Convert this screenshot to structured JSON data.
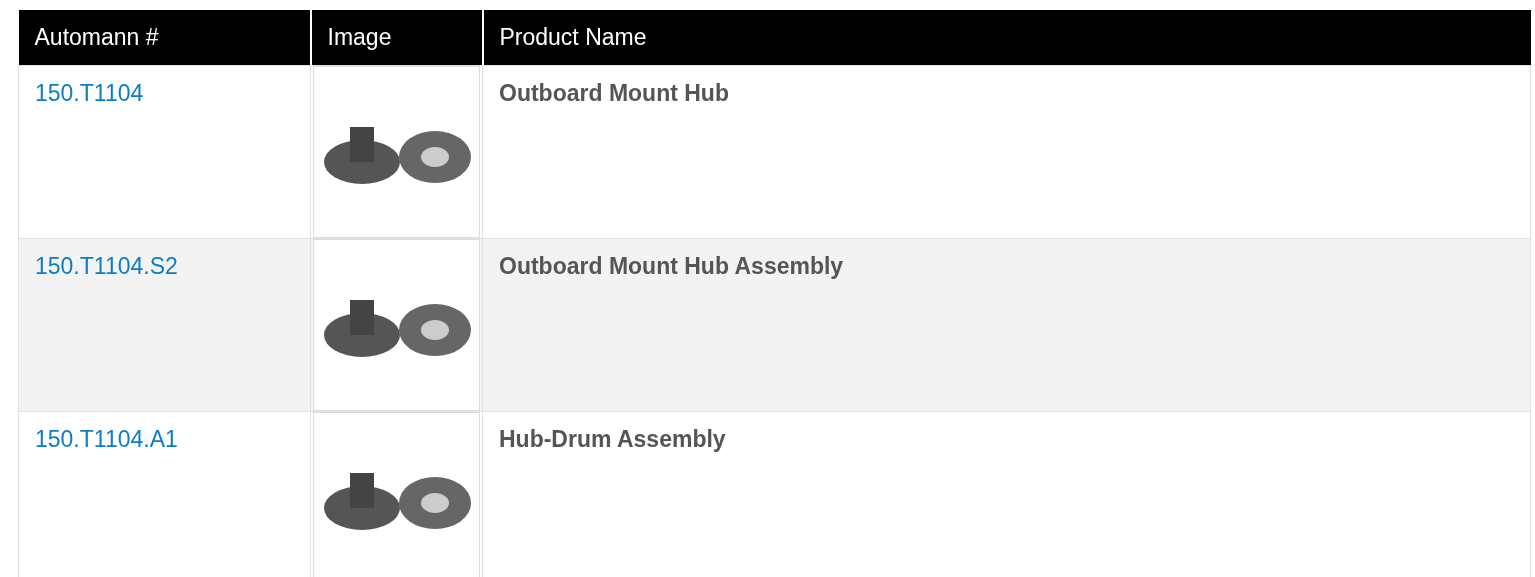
{
  "table": {
    "columns": [
      "Automann #",
      "Image",
      "Product Name"
    ],
    "rows": [
      {
        "part_number": "150.T1104",
        "product_name": "Outboard Mount Hub"
      },
      {
        "part_number": "150.T1104.S2",
        "product_name": "Outboard Mount Hub Assembly"
      },
      {
        "part_number": "150.T1104.A1",
        "product_name": "Hub-Drum Assembly"
      }
    ]
  }
}
